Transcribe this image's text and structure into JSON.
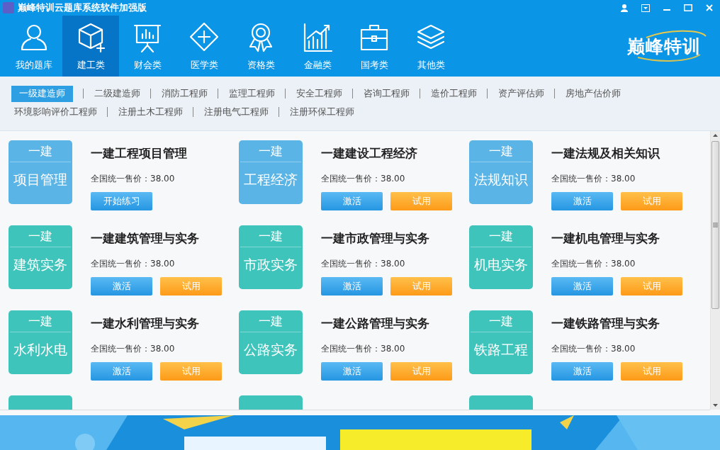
{
  "window": {
    "title": "巅峰特训云题库系统软件加强版"
  },
  "nav": [
    {
      "label": "我的题库",
      "selected": false
    },
    {
      "label": "建工类",
      "selected": true
    },
    {
      "label": "财会类",
      "selected": false
    },
    {
      "label": "医学类",
      "selected": false
    },
    {
      "label": "资格类",
      "selected": false
    },
    {
      "label": "金融类",
      "selected": false
    },
    {
      "label": "国考类",
      "selected": false
    },
    {
      "label": "其他类",
      "selected": false
    }
  ],
  "logo": {
    "text": "巅峰特训"
  },
  "sub_tabs": [
    [
      {
        "label": "一级建造师",
        "selected": true
      },
      {
        "label": "二级建造师",
        "selected": false
      },
      {
        "label": "消防工程师",
        "selected": false
      },
      {
        "label": "监理工程师",
        "selected": false
      },
      {
        "label": "安全工程师",
        "selected": false
      },
      {
        "label": "咨询工程师",
        "selected": false
      },
      {
        "label": "造价工程师",
        "selected": false
      },
      {
        "label": "资产评估师",
        "selected": false
      },
      {
        "label": "房地产估价师",
        "selected": false
      }
    ],
    [
      {
        "label": "环境影响评价工程师",
        "selected": false
      },
      {
        "label": "注册土木工程师",
        "selected": false
      },
      {
        "label": "注册电气工程师",
        "selected": false
      },
      {
        "label": "注册环保工程师",
        "selected": false
      }
    ]
  ],
  "courses": [
    {
      "tag": "一建",
      "short": "项目管理",
      "color": "#5ab4e5",
      "title": "一建工程项目管理",
      "price": "全国统一售价：38.00",
      "buttons": [
        {
          "kind": "main",
          "label": "开始练习"
        }
      ]
    },
    {
      "tag": "一建",
      "short": "工程经济",
      "color": "#5ab4e5",
      "title": "一建建设工程经济",
      "price": "全国统一售价：38.00",
      "buttons": [
        {
          "kind": "main",
          "label": "激活"
        },
        {
          "kind": "trial",
          "label": "试用"
        }
      ]
    },
    {
      "tag": "一建",
      "short": "法规知识",
      "color": "#5ab4e5",
      "title": "一建法规及相关知识",
      "price": "全国统一售价：38.00",
      "buttons": [
        {
          "kind": "main",
          "label": "激活"
        },
        {
          "kind": "trial",
          "label": "试用"
        }
      ]
    },
    {
      "tag": "一建",
      "short": "建筑实务",
      "color": "#3fc4bc",
      "title": "一建建筑管理与实务",
      "price": "全国统一售价：38.00",
      "buttons": [
        {
          "kind": "main",
          "label": "激活"
        },
        {
          "kind": "trial",
          "label": "试用"
        }
      ]
    },
    {
      "tag": "一建",
      "short": "市政实务",
      "color": "#3fc4bc",
      "title": "一建市政管理与实务",
      "price": "全国统一售价：38.00",
      "buttons": [
        {
          "kind": "main",
          "label": "激活"
        },
        {
          "kind": "trial",
          "label": "试用"
        }
      ]
    },
    {
      "tag": "一建",
      "short": "机电实务",
      "color": "#3fc4bc",
      "title": "一建机电管理与实务",
      "price": "全国统一售价：38.00",
      "buttons": [
        {
          "kind": "main",
          "label": "激活"
        },
        {
          "kind": "trial",
          "label": "试用"
        }
      ]
    },
    {
      "tag": "一建",
      "short": "水利水电",
      "color": "#3fc4bc",
      "title": "一建水利管理与实务",
      "price": "全国统一售价：38.00",
      "buttons": [
        {
          "kind": "main",
          "label": "激活"
        },
        {
          "kind": "trial",
          "label": "试用"
        }
      ]
    },
    {
      "tag": "一建",
      "short": "公路实务",
      "color": "#3fc4bc",
      "title": "一建公路管理与实务",
      "price": "全国统一售价：38.00",
      "buttons": [
        {
          "kind": "main",
          "label": "激活"
        },
        {
          "kind": "trial",
          "label": "试用"
        }
      ]
    },
    {
      "tag": "一建",
      "short": "铁路工程",
      "color": "#3fc4bc",
      "title": "一建铁路管理与实务",
      "price": "全国统一售价：38.00",
      "buttons": [
        {
          "kind": "main",
          "label": "激活"
        },
        {
          "kind": "trial",
          "label": "试用"
        }
      ]
    },
    {
      "color": "#3fc4bc"
    },
    {
      "color": "#3fc4bc"
    },
    {
      "color": "#3fc4bc"
    }
  ]
}
